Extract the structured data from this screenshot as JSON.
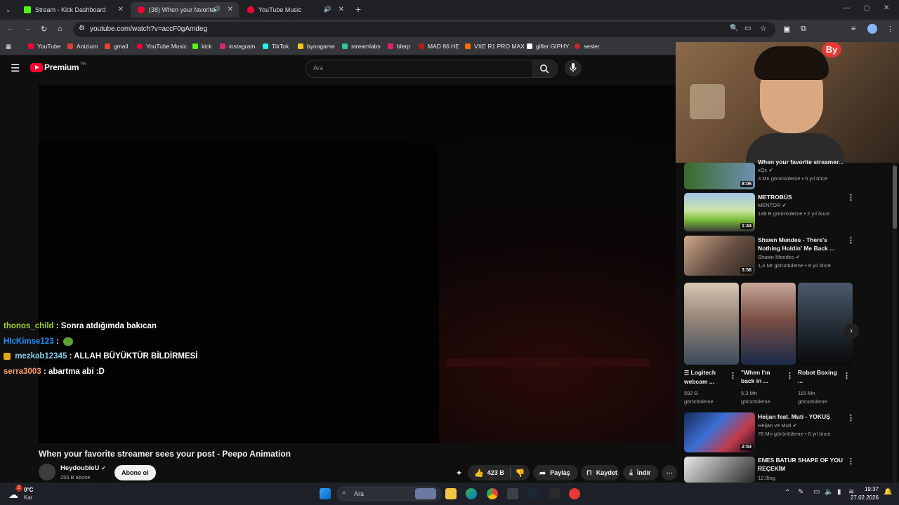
{
  "tabs": [
    {
      "title": "Stream - Kick Dashboard",
      "color": "#53fc18"
    },
    {
      "title": "(38) When your favorite stre",
      "color": "#ff0033"
    },
    {
      "title": "YouTube Music",
      "color": "#ff0033"
    }
  ],
  "address": {
    "url": "youtube.com/watch?v=accF0gAmdeg"
  },
  "bookmarks": [
    {
      "label": "YouTube",
      "color": "#ff0033"
    },
    {
      "label": "Anizium",
      "color": "#e53935"
    },
    {
      "label": "gmail",
      "color": "#ea4335"
    },
    {
      "label": "YouTube Music",
      "color": "#ff0033"
    },
    {
      "label": "kick",
      "color": "#53fc18"
    },
    {
      "label": "instagram",
      "color": "#d62976"
    },
    {
      "label": "TikTok",
      "color": "#25f4ee"
    },
    {
      "label": "bynogame",
      "color": "#f5c518"
    },
    {
      "label": "streamlabs",
      "color": "#31c3a2"
    },
    {
      "label": "blerp",
      "color": "#e91e63"
    },
    {
      "label": "MAD 86 HE",
      "color": "#b71c1c"
    },
    {
      "label": "VXE R1 PRO MAX",
      "color": "#ff6d00"
    },
    {
      "label": "gifler GIPHY",
      "color": "#ffffff"
    },
    {
      "label": "sesler",
      "color": "#c62828"
    }
  ],
  "youtube": {
    "logo_text": "Premium",
    "region": "TR",
    "search_placeholder": "Ara"
  },
  "overlay": {
    "tag": "By"
  },
  "chat": [
    {
      "user": "thonos_child",
      "user_color": "#9acd32",
      "message": ": Sonra atdığımda bakıcan"
    },
    {
      "user": "HIcKimse123",
      "user_color": "#1e90ff",
      "message": ":"
    },
    {
      "user": "mezkab12345",
      "user_color": "#87ceeb",
      "message": ": ALLAH BÜYÜKTÜR BİLDİRMESİ"
    },
    {
      "user": "serra3003",
      "user_color": "#ff9966",
      "message": ": abartma abi :D"
    }
  ],
  "video": {
    "title": "When your favorite streamer sees your post - Peepo Animation",
    "channel": "HeydoubleU",
    "subscribers": "256 B abone",
    "subscribe_label": "Abone ol",
    "likes": "423 B",
    "share_label": "Paylaş",
    "save_label": "Kaydet",
    "download_label": "İndir"
  },
  "recommendations": [
    {
      "title": "When your favorite streamer...",
      "channel": "xQc",
      "meta": "3 Mn görüntüleme • 5 yıl önce",
      "duration": "8:06"
    },
    {
      "title": "METROBÜS",
      "channel": "MENTOR",
      "meta": "148 B görüntüleme • 2 yıl önce",
      "duration": "1:44"
    },
    {
      "title": "Shawn Mendes - There's Nothing Holdin' Me Back ...",
      "channel": "Shawn Mendes",
      "meta": "1,4 Mr görüntüleme • 8 yıl önce",
      "duration": "3:58"
    },
    {
      "title": "Heijan feat. Muti - YOKUŞ",
      "channel": "Heijan ve Muti",
      "meta": "78 Mn görüntüleme • 6 yıl önce",
      "duration": "2:53"
    },
    {
      "title": "ENES BATUR SHAPE OF YOU REÇEKİM",
      "channel": "12.ßlog",
      "meta": "",
      "duration": ""
    }
  ],
  "shorts": [
    {
      "title": "Logitech webcam ...",
      "views": "592 B görüntüleme"
    },
    {
      "title": "\"When I'm back in ...",
      "views": "5,3 Mn görüntüleme"
    },
    {
      "title": "Robot Boxing ...",
      "views": "115 Mn görüntüleme"
    }
  ],
  "taskbar": {
    "weather_temp": "0°C",
    "weather_desc": "Kar",
    "search_label": "Ara",
    "time": "19:37",
    "date": "27.02.2026",
    "badge": "2"
  }
}
